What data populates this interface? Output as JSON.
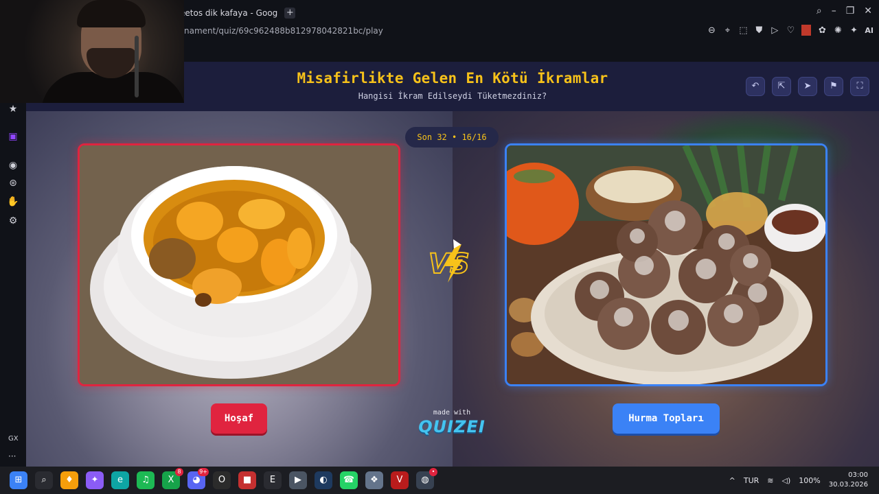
{
  "browser": {
    "tab_title": "eetos dik kafaya - Goog",
    "tab_add_label": "+",
    "url": "nament/quiz/69c962488b812978042821bc/play",
    "window_controls": [
      "⌕",
      "–",
      "❐",
      "✕"
    ],
    "extensions": [
      "⊖",
      "⌖",
      "⬚",
      "⛊",
      "▷",
      "♡",
      "✿",
      "✺",
      "✦"
    ],
    "ai_label": "AI"
  },
  "sidebar": {
    "icons": [
      "★",
      "▣",
      "◉",
      "⊛",
      "✋",
      "⚙"
    ],
    "gx_label": "GX",
    "more_label": "···"
  },
  "quiz": {
    "title": "Misafirlikte Gelen En Kötü İkramlar",
    "subtitle": "Hangisi İkram Edilseydi Tüketmezdiniz?",
    "round_label": "Son 32 • 16/16",
    "header_actions": [
      "↶",
      "⇱",
      "➤",
      "⚑",
      "⛶"
    ],
    "left_option": "Hoşaf",
    "right_option": "Hurma Topları",
    "left_color": "#e0243f",
    "right_color": "#3b82f6",
    "accent_color": "#f7c21a",
    "made_with": "made with",
    "brand": "QUIZEI"
  },
  "taskbar": {
    "apps": [
      {
        "icon": "⊞",
        "color": "#3b82f6"
      },
      {
        "icon": "⌕",
        "color": "#2a2b31"
      },
      {
        "icon": "♦",
        "color": "#f59e0b"
      },
      {
        "icon": "✦",
        "color": "#8b5cf6"
      },
      {
        "icon": "e",
        "color": "#0ea5a4"
      },
      {
        "icon": "♫",
        "color": "#1db954"
      },
      {
        "icon": "X",
        "color": "#16a34a",
        "badge": "8"
      },
      {
        "icon": "◕",
        "color": "#5865f2",
        "badge": "9+"
      },
      {
        "icon": "O",
        "color": "#2b2b2b"
      },
      {
        "icon": "■",
        "color": "#c53030"
      },
      {
        "icon": "E",
        "color": "#2a2b31"
      },
      {
        "icon": "▶",
        "color": "#4b5563"
      },
      {
        "icon": "◐",
        "color": "#1e3a5f"
      },
      {
        "icon": "☎",
        "color": "#25d366"
      },
      {
        "icon": "❖",
        "color": "#64748b"
      },
      {
        "icon": "V",
        "color": "#b91c1c"
      },
      {
        "icon": "◍",
        "color": "#374151",
        "badge": "•"
      }
    ],
    "tray": {
      "chevron": "^",
      "language": "TUR",
      "battery": "100%",
      "time": "03:00",
      "date": "30.03.2026"
    }
  }
}
